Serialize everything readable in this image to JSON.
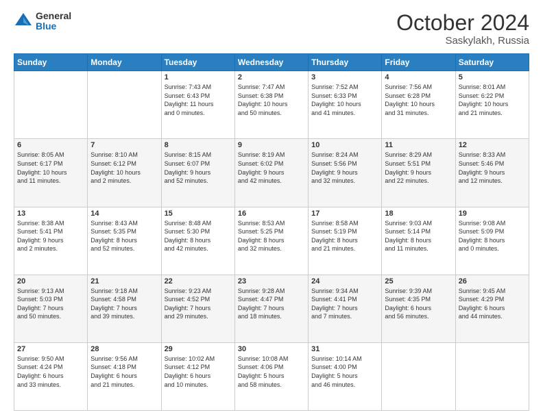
{
  "logo": {
    "general": "General",
    "blue": "Blue"
  },
  "header": {
    "month": "October 2024",
    "location": "Saskylakh, Russia"
  },
  "weekdays": [
    "Sunday",
    "Monday",
    "Tuesday",
    "Wednesday",
    "Thursday",
    "Friday",
    "Saturday"
  ],
  "weeks": [
    [
      {
        "day": "",
        "info": ""
      },
      {
        "day": "",
        "info": ""
      },
      {
        "day": "1",
        "info": "Sunrise: 7:43 AM\nSunset: 6:43 PM\nDaylight: 11 hours\nand 0 minutes."
      },
      {
        "day": "2",
        "info": "Sunrise: 7:47 AM\nSunset: 6:38 PM\nDaylight: 10 hours\nand 50 minutes."
      },
      {
        "day": "3",
        "info": "Sunrise: 7:52 AM\nSunset: 6:33 PM\nDaylight: 10 hours\nand 41 minutes."
      },
      {
        "day": "4",
        "info": "Sunrise: 7:56 AM\nSunset: 6:28 PM\nDaylight: 10 hours\nand 31 minutes."
      },
      {
        "day": "5",
        "info": "Sunrise: 8:01 AM\nSunset: 6:22 PM\nDaylight: 10 hours\nand 21 minutes."
      }
    ],
    [
      {
        "day": "6",
        "info": "Sunrise: 8:05 AM\nSunset: 6:17 PM\nDaylight: 10 hours\nand 11 minutes."
      },
      {
        "day": "7",
        "info": "Sunrise: 8:10 AM\nSunset: 6:12 PM\nDaylight: 10 hours\nand 2 minutes."
      },
      {
        "day": "8",
        "info": "Sunrise: 8:15 AM\nSunset: 6:07 PM\nDaylight: 9 hours\nand 52 minutes."
      },
      {
        "day": "9",
        "info": "Sunrise: 8:19 AM\nSunset: 6:02 PM\nDaylight: 9 hours\nand 42 minutes."
      },
      {
        "day": "10",
        "info": "Sunrise: 8:24 AM\nSunset: 5:56 PM\nDaylight: 9 hours\nand 32 minutes."
      },
      {
        "day": "11",
        "info": "Sunrise: 8:29 AM\nSunset: 5:51 PM\nDaylight: 9 hours\nand 22 minutes."
      },
      {
        "day": "12",
        "info": "Sunrise: 8:33 AM\nSunset: 5:46 PM\nDaylight: 9 hours\nand 12 minutes."
      }
    ],
    [
      {
        "day": "13",
        "info": "Sunrise: 8:38 AM\nSunset: 5:41 PM\nDaylight: 9 hours\nand 2 minutes."
      },
      {
        "day": "14",
        "info": "Sunrise: 8:43 AM\nSunset: 5:35 PM\nDaylight: 8 hours\nand 52 minutes."
      },
      {
        "day": "15",
        "info": "Sunrise: 8:48 AM\nSunset: 5:30 PM\nDaylight: 8 hours\nand 42 minutes."
      },
      {
        "day": "16",
        "info": "Sunrise: 8:53 AM\nSunset: 5:25 PM\nDaylight: 8 hours\nand 32 minutes."
      },
      {
        "day": "17",
        "info": "Sunrise: 8:58 AM\nSunset: 5:19 PM\nDaylight: 8 hours\nand 21 minutes."
      },
      {
        "day": "18",
        "info": "Sunrise: 9:03 AM\nSunset: 5:14 PM\nDaylight: 8 hours\nand 11 minutes."
      },
      {
        "day": "19",
        "info": "Sunrise: 9:08 AM\nSunset: 5:09 PM\nDaylight: 8 hours\nand 0 minutes."
      }
    ],
    [
      {
        "day": "20",
        "info": "Sunrise: 9:13 AM\nSunset: 5:03 PM\nDaylight: 7 hours\nand 50 minutes."
      },
      {
        "day": "21",
        "info": "Sunrise: 9:18 AM\nSunset: 4:58 PM\nDaylight: 7 hours\nand 39 minutes."
      },
      {
        "day": "22",
        "info": "Sunrise: 9:23 AM\nSunset: 4:52 PM\nDaylight: 7 hours\nand 29 minutes."
      },
      {
        "day": "23",
        "info": "Sunrise: 9:28 AM\nSunset: 4:47 PM\nDaylight: 7 hours\nand 18 minutes."
      },
      {
        "day": "24",
        "info": "Sunrise: 9:34 AM\nSunset: 4:41 PM\nDaylight: 7 hours\nand 7 minutes."
      },
      {
        "day": "25",
        "info": "Sunrise: 9:39 AM\nSunset: 4:35 PM\nDaylight: 6 hours\nand 56 minutes."
      },
      {
        "day": "26",
        "info": "Sunrise: 9:45 AM\nSunset: 4:29 PM\nDaylight: 6 hours\nand 44 minutes."
      }
    ],
    [
      {
        "day": "27",
        "info": "Sunrise: 9:50 AM\nSunset: 4:24 PM\nDaylight: 6 hours\nand 33 minutes."
      },
      {
        "day": "28",
        "info": "Sunrise: 9:56 AM\nSunset: 4:18 PM\nDaylight: 6 hours\nand 21 minutes."
      },
      {
        "day": "29",
        "info": "Sunrise: 10:02 AM\nSunset: 4:12 PM\nDaylight: 6 hours\nand 10 minutes."
      },
      {
        "day": "30",
        "info": "Sunrise: 10:08 AM\nSunset: 4:06 PM\nDaylight: 5 hours\nand 58 minutes."
      },
      {
        "day": "31",
        "info": "Sunrise: 10:14 AM\nSunset: 4:00 PM\nDaylight: 5 hours\nand 46 minutes."
      },
      {
        "day": "",
        "info": ""
      },
      {
        "day": "",
        "info": ""
      }
    ]
  ]
}
